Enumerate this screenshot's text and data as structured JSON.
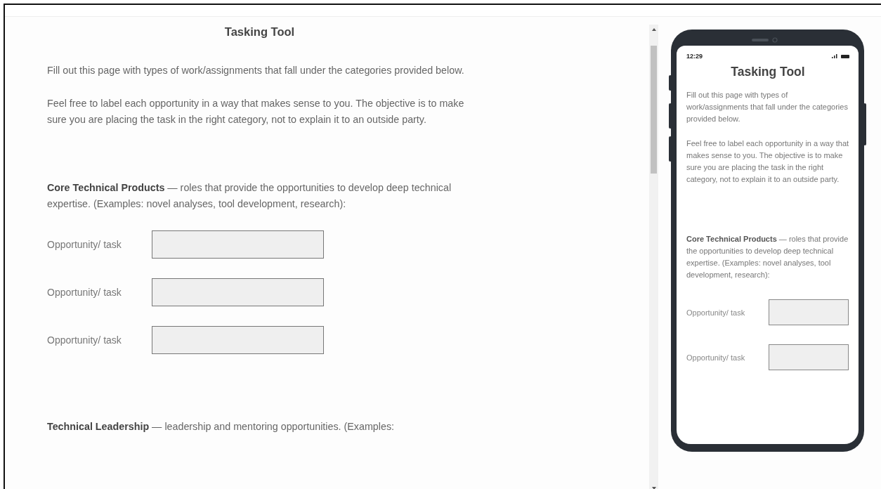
{
  "page": {
    "title": "Tasking Tool",
    "intro": [
      "Fill out this page with types of work/assignments that fall under the categories provided below.",
      "Feel free to label each opportunity in a way that makes sense to you. The objective is to make sure you are placing the task in the right category, not to explain it to an outside party."
    ],
    "sections": [
      {
        "text": "**Core Technical Products** — roles that provide the opportunities to develop deep technical expertise. (Examples: novel analyses, tool development, research):",
        "fields": [
          {
            "label": "Opportunity/ task"
          },
          {
            "label": "Opportunity/ task"
          },
          {
            "label": "Opportunity/ task"
          }
        ]
      },
      {
        "text": "**Technical Leadership** — leadership and mentoring opportunities. (Examples:"
      }
    ]
  },
  "preview": {
    "time": "12:29",
    "title": "Tasking Tool",
    "intro": [
      "Fill out this page with types of work/assignments that fall under the categories provided below.",
      "Feel free to label each opportunity in a way that makes sense to you. The objective is to make sure you are placing the task in the right category, not to explain it to an outside party."
    ],
    "sections": [
      {
        "text": "**Core Technical Products** — roles that provide the opportunities to develop deep technical expertise. (Examples: novel analyses, tool development, research):",
        "fields": [
          {
            "label": "Opportunity/ task"
          },
          {
            "label": "Opportunity/ task"
          }
        ]
      }
    ]
  }
}
